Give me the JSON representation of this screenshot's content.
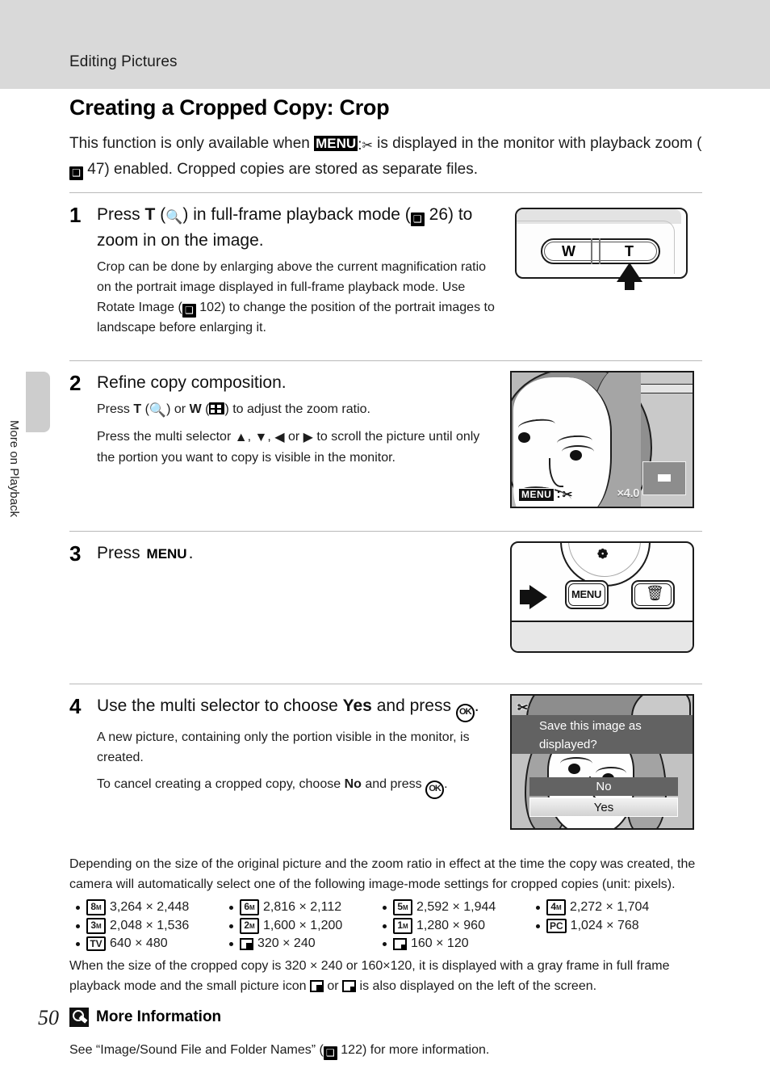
{
  "header": {
    "section_title": "Editing Pictures"
  },
  "sidebar": {
    "vertical_label": "More on Playback",
    "page_number": "50"
  },
  "page": {
    "heading": "Creating a Cropped Copy: Crop",
    "intro_part1": "This function is only available when",
    "intro_menu_icon": "MENU",
    "intro_scissors_icon": "scissors-icon",
    "intro_part2": "is displayed in the monitor with playback zoom (",
    "intro_ref_page": "47",
    "intro_part3": ") enabled. Cropped copies are stored as separate files."
  },
  "steps": [
    {
      "number": "1",
      "title_pre": "Press",
      "title_key": "T",
      "title_icon": "magnifier-icon",
      "title_mid": "in full-frame playback mode (",
      "title_ref": "26",
      "title_post": ") to zoom in on the image.",
      "body": "Crop can be done by enlarging above the current magnification ratio on the portrait image displayed in full-frame playback mode. Use Rotate Image (",
      "body_ref": "102",
      "body_post": ") to change the position of the portrait images to landscape before enlarging it.",
      "figure": {
        "name": "zoom-rocker-illustration",
        "label_wide": "W",
        "label_tele": "T"
      }
    },
    {
      "number": "2",
      "title": "Refine copy composition.",
      "body1_pre": "Press",
      "body1_key_t": "T",
      "body1_icon_t": "magnifier-icon",
      "body1_or": "or",
      "body1_key_w": "W",
      "body1_icon_w": "thumbnail-icon",
      "body1_post": "to adjust the zoom ratio.",
      "body2_pre": "Press the multi selector",
      "body2_up": "▲",
      "body2_down": "▼",
      "body2_left": "◀",
      "body2_right": "▶",
      "body2_post": "to scroll the picture until only the portion you want to copy is visible in the monitor.",
      "figure": {
        "name": "cropped-preview-monitor",
        "menu_badge": "MENU",
        "scissors": "✂",
        "zoom_ratio": "×4.0"
      }
    },
    {
      "number": "3",
      "title_pre": "Press",
      "title_key": "MENU",
      "title_post": ".",
      "figure": {
        "name": "camera-back-menu-button",
        "menu_label": "MENU",
        "trash_label": "🗑",
        "macro_label": "❁"
      }
    },
    {
      "number": "4",
      "title_pre": "Use the multi selector to choose",
      "title_choice": "Yes",
      "title_mid": "and press",
      "title_ok": "OK",
      "title_post": ".",
      "body1": "A new picture, containing only the portion visible in the monitor, is created.",
      "body2_pre": "To cancel creating a cropped copy, choose",
      "body2_choice": "No",
      "body2_mid": "and press",
      "body2_ok": "OK",
      "body2_post": ".",
      "figure": {
        "name": "save-confirmation-dialog",
        "scissors": "✂",
        "message": "Save this image as displayed?",
        "option_no": "No",
        "option_yes": "Yes"
      }
    }
  ],
  "notes": {
    "image_mode_intro": "Depending on the size of the original picture and the zoom ratio in effect at the time the copy was created, the camera will automatically select one of the following image-mode settings for cropped copies (unit: pixels).",
    "image_modes": [
      {
        "badge": "8",
        "badge_sub": "M",
        "badge_type": "mode",
        "size": "3,264 × 2,448"
      },
      {
        "badge": "6",
        "badge_sub": "M",
        "badge_type": "mode",
        "size": "2,816 × 2,112"
      },
      {
        "badge": "5",
        "badge_sub": "M",
        "badge_type": "mode",
        "size": "2,592 × 1,944"
      },
      {
        "badge": "4",
        "badge_sub": "M",
        "badge_type": "mode",
        "size": "2,272 × 1,704"
      },
      {
        "badge": "3",
        "badge_sub": "M",
        "badge_type": "mode",
        "size": "2,048 × 1,536"
      },
      {
        "badge": "2",
        "badge_sub": "M",
        "badge_type": "mode",
        "size": "1,600 × 1,200"
      },
      {
        "badge": "1",
        "badge_sub": "M",
        "badge_type": "mode",
        "size": "1,280 × 960"
      },
      {
        "badge": "PC",
        "badge_sub": "",
        "badge_type": "mode",
        "size": "1,024 × 768"
      },
      {
        "badge": "TV",
        "badge_sub": "",
        "badge_type": "mode",
        "size": "640 × 480"
      },
      {
        "badge": "",
        "badge_sub": "",
        "badge_type": "small-pic",
        "size": "320 × 240"
      },
      {
        "badge": "",
        "badge_sub": "",
        "badge_type": "tiny-pic",
        "size": "160 × 120"
      }
    ],
    "gray_frame_note_pre": "When the size of the cropped copy is 320 × 240 or 160×120, it is displayed with a gray frame in full frame playback mode and the small picture icon",
    "gray_frame_note_or": "or",
    "gray_frame_note_post": "is also displayed on the left of the screen."
  },
  "more_information": {
    "icon": "magnifier-note-icon",
    "title": "More Information",
    "body_pre": "See “Image/Sound File and Folder Names” (",
    "body_ref": "122",
    "body_post": ") for more information."
  },
  "colors": {
    "header_band": "#d9d9d9",
    "text": "#1d1d1d",
    "rule": "#b9b9b9"
  }
}
